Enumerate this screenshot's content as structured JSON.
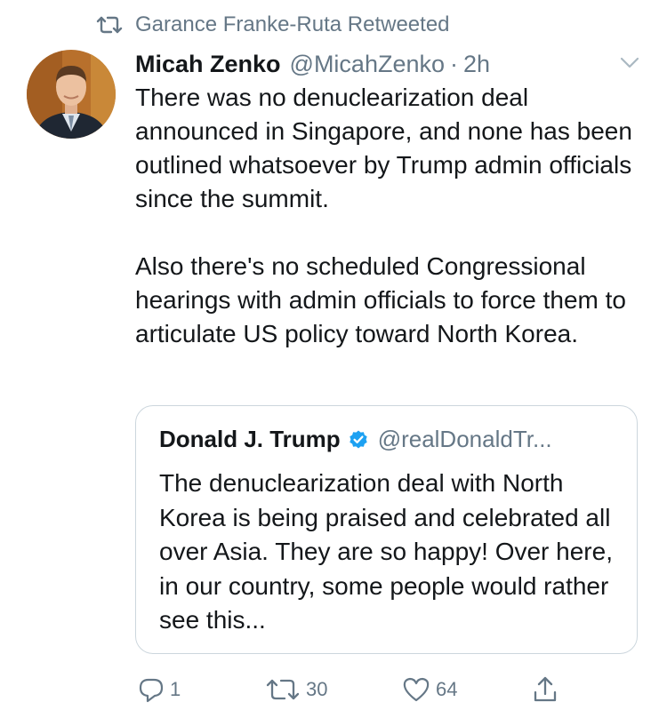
{
  "retweet": {
    "icon": "retweet-icon",
    "text": "Garance Franke-Ruta Retweeted"
  },
  "tweet": {
    "author_name": "Micah Zenko",
    "author_handle": "@MicahZenko",
    "separator": "·",
    "time": "2h",
    "text": "There was no denuclearization deal announced in Singapore, and none has been outlined whatsoever by Trump admin officials since the summit.\n\nAlso there's no scheduled Congressional hearings with admin officials to force them to articulate US policy toward North Korea.",
    "menu_icon": "chevron-down-icon"
  },
  "quote": {
    "author_name": "Donald J. Trump",
    "verified_icon": "verified-badge-icon",
    "author_handle": "@realDonaldTr...",
    "text": "The denuclearization deal with North Korea is being praised and celebrated all over Asia. They are so happy! Over here, in our country, some people would rather see this..."
  },
  "actions": {
    "reply_count": "1",
    "retweet_count": "30",
    "like_count": "64"
  },
  "colors": {
    "text": "#14171a",
    "secondary": "#657786",
    "border": "#ccd6dd",
    "verified": "#1da1f2"
  }
}
